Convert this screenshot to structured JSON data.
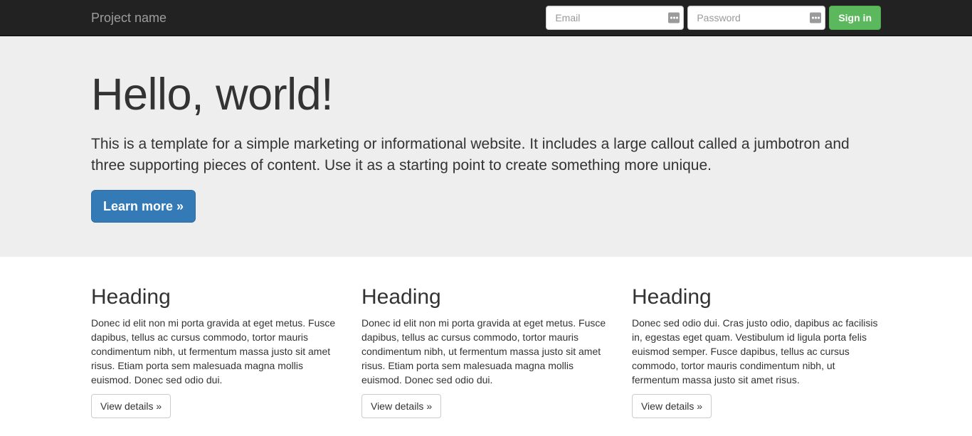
{
  "navbar": {
    "brand": "Project name",
    "email_placeholder": "Email",
    "password_placeholder": "Password",
    "email_value": "",
    "password_value": "",
    "signin_label": "Sign in",
    "autofill_icon": "form-autofill-icon",
    "bg_color": "#222222",
    "brand_color": "#9d9d9d",
    "signin_color": "#5cb85c"
  },
  "jumbotron": {
    "heading": "Hello, world!",
    "lead": "This is a template for a simple marketing or informational website. It includes a large callout called a jumbotron and three supporting pieces of content. Use it as a starting point to create something more unique.",
    "cta_label": "Learn more »",
    "bg_color": "#eeeeee",
    "cta_color": "#337ab7"
  },
  "columns": [
    {
      "heading": "Heading",
      "body": "Donec id elit non mi porta gravida at eget metus. Fusce dapibus, tellus ac cursus commodo, tortor mauris condimentum nibh, ut fermentum massa justo sit amet risus. Etiam porta sem malesuada magna mollis euismod. Donec sed odio dui.",
      "button_label": "View details »"
    },
    {
      "heading": "Heading",
      "body": "Donec id elit non mi porta gravida at eget metus. Fusce dapibus, tellus ac cursus commodo, tortor mauris condimentum nibh, ut fermentum massa justo sit amet risus. Etiam porta sem malesuada magna mollis euismod. Donec sed odio dui.",
      "button_label": "View details »"
    },
    {
      "heading": "Heading",
      "body": "Donec sed odio dui. Cras justo odio, dapibus ac facilisis in, egestas eget quam. Vestibulum id ligula porta felis euismod semper. Fusce dapibus, tellus ac cursus commodo, tortor mauris condimentum nibh, ut fermentum massa justo sit amet risus.",
      "button_label": "View details »"
    }
  ]
}
